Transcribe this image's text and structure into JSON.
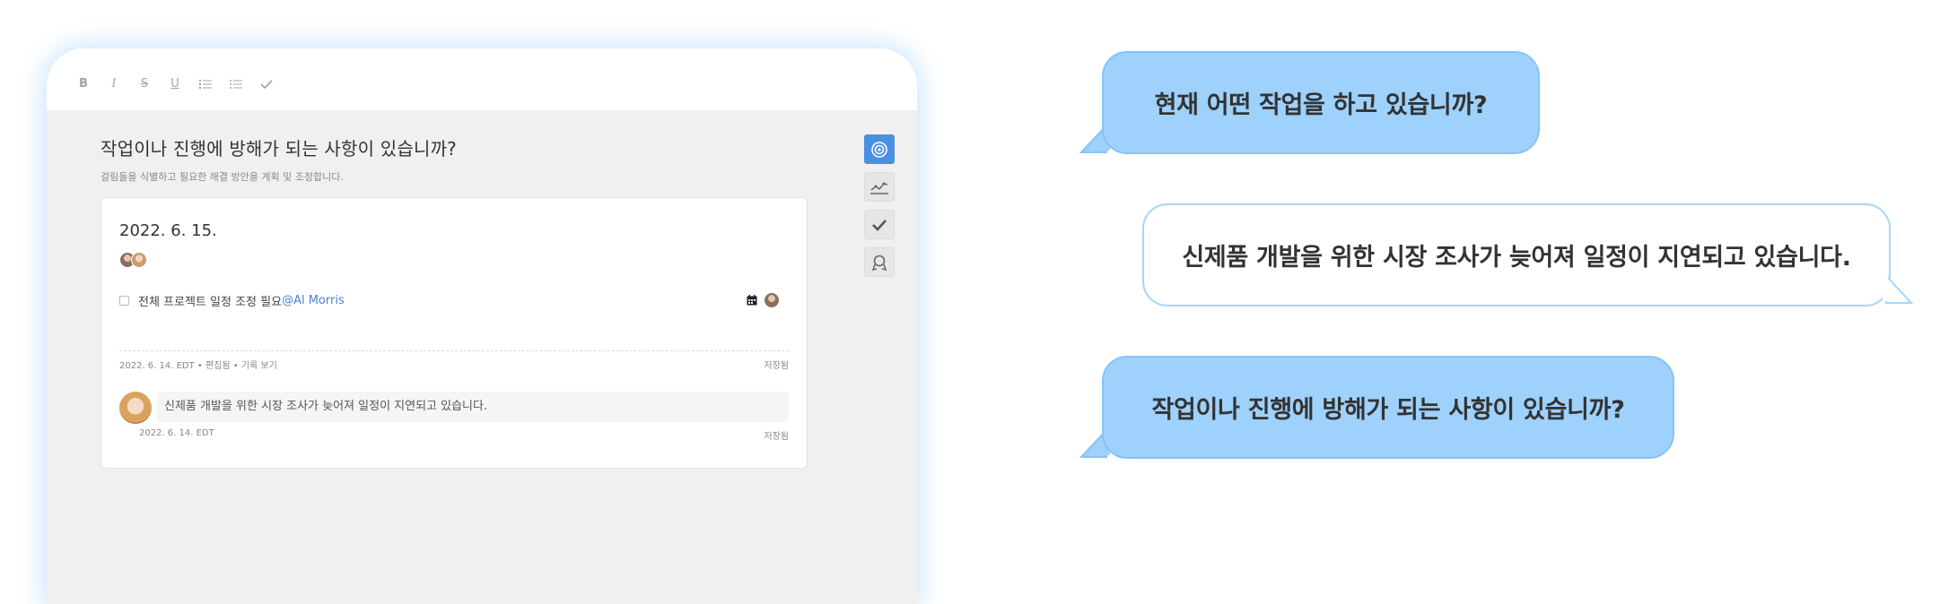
{
  "editor": {
    "toolbar": [
      {
        "label": "B",
        "name": "bold-button",
        "cls": "b"
      },
      {
        "label": "I",
        "name": "italic-button",
        "cls": "i"
      },
      {
        "label": "S",
        "name": "strikethrough-button",
        "cls": "s"
      },
      {
        "label": "U",
        "name": "underline-button",
        "cls": "u"
      }
    ],
    "toolbar_icons": [
      "ordered-list-icon",
      "bullet-list-icon",
      "check-icon"
    ],
    "question_title": "작업이나 진행에 방해가 되는 사항이 있습니까?",
    "question_subtitle": "걸림돌을 식별하고 필요한 해결 방안을 계획 및 조정합니다.",
    "side_icons": [
      "target-icon",
      "chart-icon",
      "checkmark-icon",
      "award-icon"
    ],
    "entry": {
      "date": "2022. 6. 15.",
      "task_text": "전체 프로젝트 일정 조정 필요",
      "task_mention": "@Al Morris",
      "meta_left": "2022. 6. 14. EDT • 편집됨 • 기록 보기",
      "meta_right": "저장됨",
      "comment_text": "신제품 개발을 위한 시장 조사가 늦어져 일정이 지연되고 있습니다.",
      "comment_meta_left": "2022. 6. 14. EDT",
      "comment_meta_right": "저장됨"
    }
  },
  "bubbles": {
    "first": "현재 어떤 작업을 하고 있습니까?",
    "second": "신제품 개발을 위한 시장 조사가 늦어져 일정이 지연되고 있습니다.",
    "third": "작업이나 진행에 방해가 되는 사항이 있습니까?"
  },
  "colors": {
    "accent": "#4a90e2",
    "bubble_blue": "#9ed1fb",
    "bubble_border": "#88c3f5",
    "mention": "#4a7fd1"
  }
}
